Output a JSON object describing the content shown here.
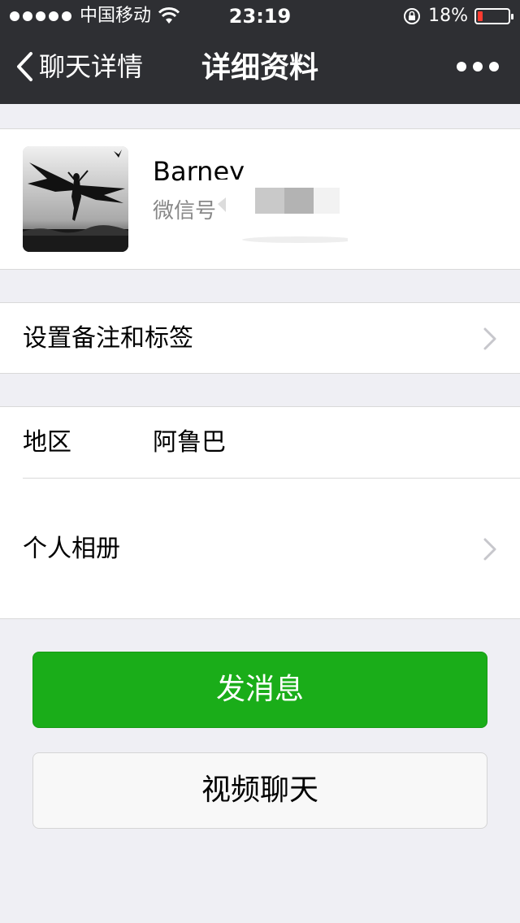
{
  "status_bar": {
    "carrier": "中国移动",
    "time": "23:19",
    "battery_percent": "18%",
    "battery_level": 0.18,
    "battery_color": "#ff3b30"
  },
  "nav": {
    "back_label": "聊天详情",
    "title": "详细资料",
    "back_icon": "chevron-left-icon",
    "more_icon": "more-dots-icon"
  },
  "profile": {
    "name": "Barney",
    "wechat_id_label": "微信号"
  },
  "remark_row": {
    "label": "设置备注和标签"
  },
  "info": {
    "region_label": "地区",
    "region_value": "阿鲁巴",
    "album_label": "个人相册"
  },
  "actions": {
    "message_button": "发消息",
    "video_button": "视频聊天"
  },
  "colors": {
    "header_bg": "#2e2f33",
    "primary_green": "#1aad19",
    "page_bg": "#efeff4"
  }
}
